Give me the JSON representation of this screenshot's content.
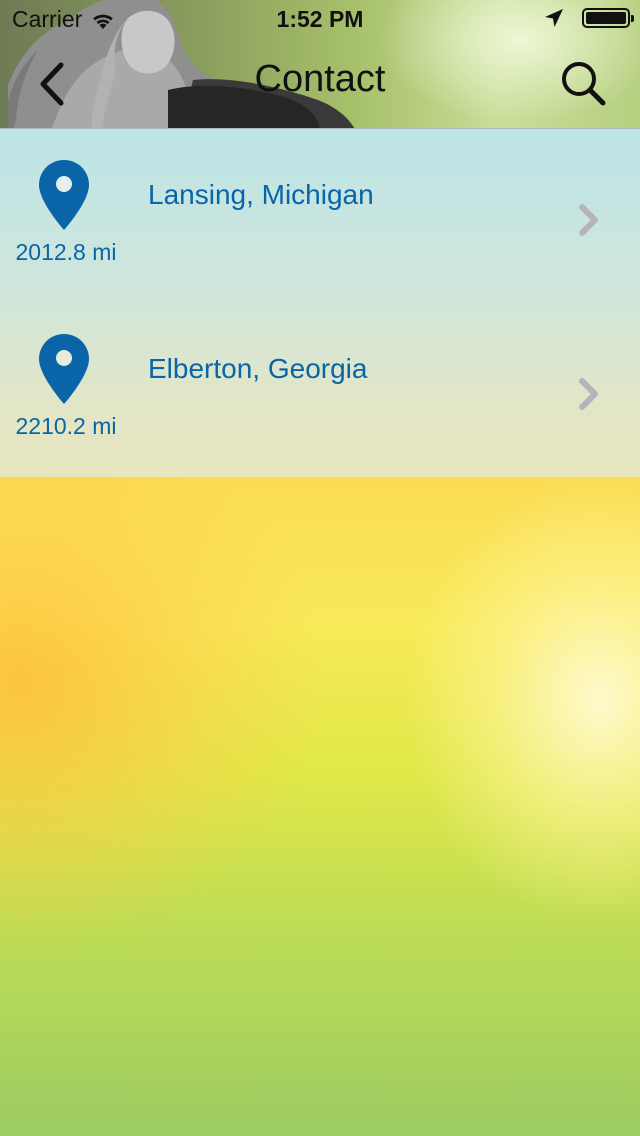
{
  "status_bar": {
    "carrier": "Carrier",
    "time": "1:52 PM",
    "battery_level": 1.0,
    "icons": [
      "wifi-icon",
      "location-arrow-icon",
      "battery-icon"
    ]
  },
  "nav": {
    "title": "Contact",
    "back_icon": "chevron-left-icon",
    "search_icon": "search-icon"
  },
  "locations": [
    {
      "name": "Lansing, Michigan",
      "distance": "2012.8 mi",
      "icon": "map-pin-icon"
    },
    {
      "name": "Elberton, Georgia",
      "distance": "2210.2 mi",
      "icon": "map-pin-icon"
    }
  ],
  "colors": {
    "accent": "#0a64a8",
    "chevron": "#b4b4ba",
    "text_dark": "#111111"
  }
}
